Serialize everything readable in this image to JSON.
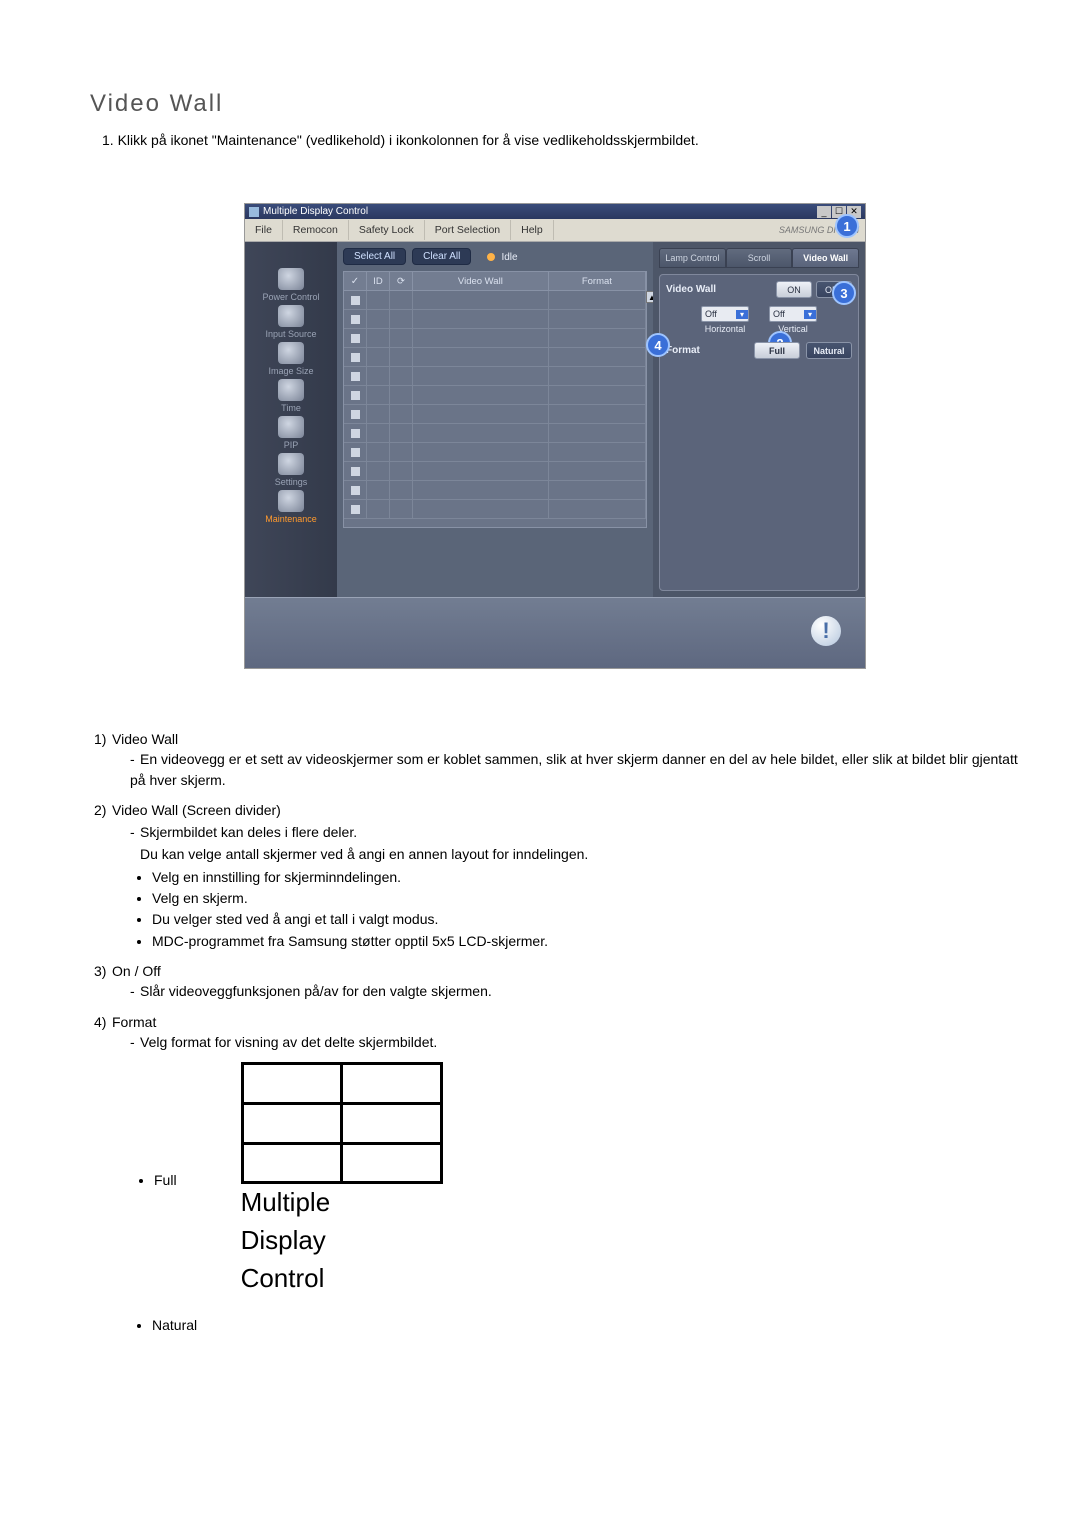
{
  "title": "Video Wall",
  "intro_num": "1.",
  "intro": "Klikk på ikonet \"Maintenance\" (vedlikehold) i ikonkolonnen for å vise vedlikeholdsskjermbildet.",
  "screenshot": {
    "window_title": "Multiple Display Control",
    "sys": {
      "min": "_",
      "max": "☐",
      "close": "✕"
    },
    "menu": [
      "File",
      "Remocon",
      "Safety Lock",
      "Port Selection",
      "Help"
    ],
    "brand": "SAMSUNG DIGITall",
    "sidebar": [
      {
        "label": "Power Control"
      },
      {
        "label": "Input Source"
      },
      {
        "label": "Image Size"
      },
      {
        "label": "Time"
      },
      {
        "label": "PIP"
      },
      {
        "label": "Settings"
      },
      {
        "label": "Maintenance"
      }
    ],
    "toolbar": {
      "select_all": "Select All",
      "clear_all": "Clear All",
      "idle": "Idle"
    },
    "grid_headers": {
      "chk": "✓",
      "id": "ID",
      "icon": "⟳",
      "videowall": "Video Wall",
      "format": "Format"
    },
    "tabs": [
      "Lamp Control",
      "Scroll",
      "Video Wall"
    ],
    "panel": {
      "vw_label": "Video Wall",
      "on": "ON",
      "off": "OFF",
      "h_sel": "Off",
      "h_lbl": "Horizontal",
      "v_sel": "Off",
      "v_lbl": "Vertical",
      "format_lbl": "Format",
      "full": "Full",
      "natural": "Natural"
    },
    "badges": {
      "b1": "1",
      "b2": "2",
      "b3": "3",
      "b4": "4"
    },
    "info": "!"
  },
  "explain": {
    "i1_num": "1)",
    "i1_title": "Video Wall",
    "i1_line": "En videovegg er et sett av videoskjermer som er koblet sammen, slik at hver skjerm danner en del av hele bildet, eller slik at bildet blir gjentatt på hver skjerm.",
    "i2_num": "2)",
    "i2_title": "Video Wall (Screen divider)",
    "i2_l1": "Skjermbildet kan deles i flere deler.",
    "i2_l2": "Du kan velge antall skjermer ved å angi en annen layout for inndelingen.",
    "i2_b1": "Velg en innstilling for skjerminndelingen.",
    "i2_b2": "Velg en skjerm.",
    "i2_b3": "Du velger sted ved å angi et tall i valgt modus.",
    "i2_b4": "MDC-programmet fra Samsung støtter opptil 5x5 LCD-skjermer.",
    "i3_num": "3)",
    "i3_title": "On / Off",
    "i3_line": "Slår videoveggfunksjonen på/av for den valgte skjermen.",
    "i4_num": "4)",
    "i4_title": "Format",
    "i4_line": "Velg format for visning av det delte skjermbildet.",
    "full_label": "Full",
    "natural_label": "Natural",
    "diagram_l1": "Multiple",
    "diagram_l2": "Display",
    "diagram_l3": "Control"
  }
}
